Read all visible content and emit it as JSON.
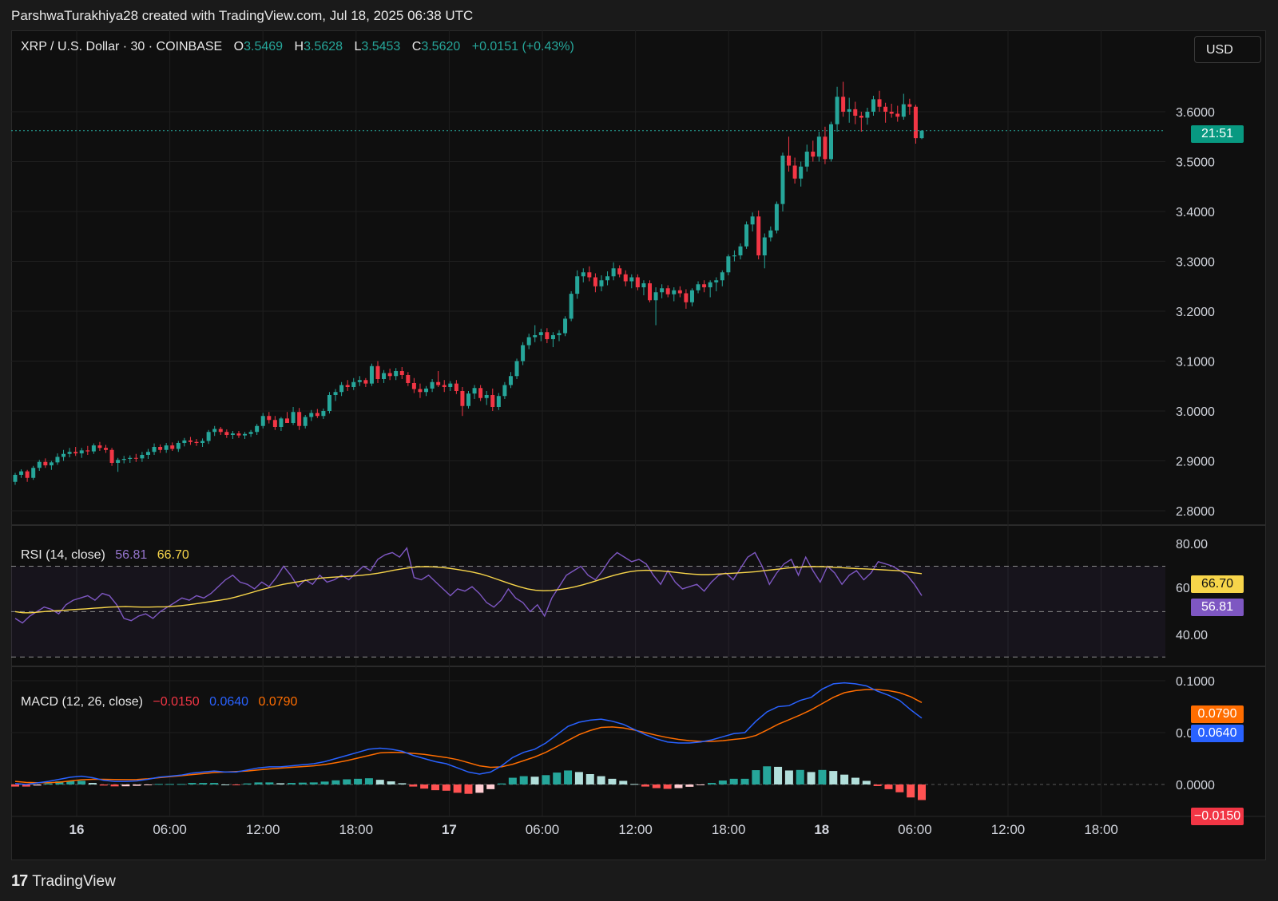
{
  "header": {
    "attribution": "ParshwaTurakhiya28 created with TradingView.com, Jul 18, 2025 06:38 UTC"
  },
  "symbol": {
    "title": "XRP / U.S. Dollar · 30 · COINBASE",
    "o_label": "O",
    "o": "3.5469",
    "h_label": "H",
    "h": "3.5628",
    "l_label": "L",
    "l": "3.5453",
    "c_label": "C",
    "c": "3.5620",
    "change": "+0.0151 (+0.43%)"
  },
  "currency_button": "USD",
  "price_tag": "21:51",
  "rsi": {
    "label": "RSI (14, close)",
    "value": "56.81",
    "ma": "66.70",
    "partial_tick": "60.00"
  },
  "macd": {
    "label": "MACD (12, 26, close)",
    "hist": "−0.0150",
    "macd": "0.0640",
    "signal": "0.0790"
  },
  "footer": {
    "brand": "TradingView",
    "logo_mark": "17"
  },
  "colors": {
    "up": "#26a69a",
    "down": "#f23645",
    "rsi_line": "#7e57c2",
    "rsi_ma": "#f7d54a",
    "macd_line": "#2962ff",
    "signal_line": "#ff6d00",
    "bg": "#0f0f0f"
  },
  "chart_data": {
    "type": "candlestick",
    "timeframe": "30",
    "x_tick_labels": [
      "16",
      "06:00",
      "12:00",
      "18:00",
      "17",
      "06:00",
      "12:00",
      "18:00",
      "18",
      "06:00",
      "12:00",
      "18:00"
    ],
    "price_axis": {
      "ticks": [
        "3.6000",
        "3.5000",
        "3.4000",
        "3.3000",
        "3.2000",
        "3.1000",
        "3.0000",
        "2.9000",
        "2.8000"
      ],
      "last": 3.562
    },
    "rsi_axis": {
      "ticks": [
        "80.00",
        "40.00"
      ],
      "bands": [
        70,
        50,
        30
      ]
    },
    "macd_axis": {
      "ticks": [
        "0.1000",
        "0.0500",
        "0.0000"
      ]
    },
    "candles": [
      [
        2.858,
        2.876,
        2.852,
        2.872
      ],
      [
        2.872,
        2.883,
        2.866,
        2.879
      ],
      [
        2.879,
        2.882,
        2.858,
        2.866
      ],
      [
        2.866,
        2.89,
        2.862,
        2.886
      ],
      [
        2.886,
        2.902,
        2.88,
        2.898
      ],
      [
        2.898,
        2.905,
        2.886,
        2.891
      ],
      [
        2.891,
        2.9,
        2.882,
        2.897
      ],
      [
        2.897,
        2.915,
        2.892,
        2.908
      ],
      [
        2.908,
        2.922,
        2.9,
        2.914
      ],
      [
        2.914,
        2.926,
        2.907,
        2.918
      ],
      [
        2.918,
        2.928,
        2.91,
        2.915
      ],
      [
        2.915,
        2.926,
        2.906,
        2.921
      ],
      [
        2.921,
        2.93,
        2.912,
        2.919
      ],
      [
        2.919,
        2.935,
        2.914,
        2.931
      ],
      [
        2.931,
        2.938,
        2.92,
        2.926
      ],
      [
        2.926,
        2.932,
        2.916,
        2.922
      ],
      [
        2.922,
        2.926,
        2.89,
        2.896
      ],
      [
        2.896,
        2.906,
        2.878,
        2.902
      ],
      [
        2.902,
        2.91,
        2.895,
        2.904
      ],
      [
        2.904,
        2.911,
        2.896,
        2.906
      ],
      [
        2.906,
        2.914,
        2.898,
        2.905
      ],
      [
        2.905,
        2.918,
        2.898,
        2.912
      ],
      [
        2.912,
        2.924,
        2.904,
        2.918
      ],
      [
        2.918,
        2.935,
        2.912,
        2.928
      ],
      [
        2.928,
        2.933,
        2.916,
        2.922
      ],
      [
        2.922,
        2.936,
        2.916,
        2.931
      ],
      [
        2.931,
        2.937,
        2.92,
        2.924
      ],
      [
        2.924,
        2.94,
        2.918,
        2.936
      ],
      [
        2.936,
        2.946,
        2.929,
        2.941
      ],
      [
        2.941,
        2.948,
        2.932,
        2.938
      ],
      [
        2.938,
        2.944,
        2.93,
        2.936
      ],
      [
        2.936,
        2.945,
        2.928,
        2.94
      ],
      [
        2.94,
        2.962,
        2.934,
        2.958
      ],
      [
        2.958,
        2.97,
        2.95,
        2.964
      ],
      [
        2.964,
        2.968,
        2.952,
        2.958
      ],
      [
        2.958,
        2.963,
        2.946,
        2.952
      ],
      [
        2.952,
        2.96,
        2.944,
        2.955
      ],
      [
        2.955,
        2.96,
        2.946,
        2.951
      ],
      [
        2.951,
        2.958,
        2.944,
        2.954
      ],
      [
        2.954,
        2.962,
        2.948,
        2.958
      ],
      [
        2.958,
        2.974,
        2.952,
        2.97
      ],
      [
        2.97,
        2.996,
        2.965,
        2.99
      ],
      [
        2.99,
        2.998,
        2.975,
        2.982
      ],
      [
        2.982,
        2.99,
        2.962,
        2.968
      ],
      [
        2.968,
        2.988,
        2.96,
        2.985
      ],
      [
        2.985,
        2.998,
        2.978,
        2.976
      ],
      [
        2.976,
        3.008,
        2.972,
        2.998
      ],
      [
        2.998,
        3.006,
        2.962,
        2.97
      ],
      [
        2.97,
        2.992,
        2.965,
        2.988
      ],
      [
        2.988,
        3.002,
        2.98,
        2.996
      ],
      [
        2.996,
        3.004,
        2.986,
        2.99
      ],
      [
        2.99,
        3.005,
        2.984,
        3.0
      ],
      [
        3.0,
        3.038,
        2.995,
        3.032
      ],
      [
        3.032,
        3.044,
        3.02,
        3.038
      ],
      [
        3.038,
        3.058,
        3.03,
        3.052
      ],
      [
        3.052,
        3.062,
        3.04,
        3.048
      ],
      [
        3.048,
        3.066,
        3.042,
        3.058
      ],
      [
        3.058,
        3.07,
        3.05,
        3.062
      ],
      [
        3.062,
        3.066,
        3.048,
        3.055
      ],
      [
        3.055,
        3.095,
        3.05,
        3.09
      ],
      [
        3.09,
        3.1,
        3.056,
        3.064
      ],
      [
        3.064,
        3.082,
        3.056,
        3.076
      ],
      [
        3.076,
        3.085,
        3.062,
        3.07
      ],
      [
        3.07,
        3.086,
        3.062,
        3.08
      ],
      [
        3.08,
        3.088,
        3.064,
        3.072
      ],
      [
        3.072,
        3.078,
        3.05,
        3.056
      ],
      [
        3.056,
        3.066,
        3.036,
        3.044
      ],
      [
        3.044,
        3.055,
        3.026,
        3.038
      ],
      [
        3.038,
        3.05,
        3.03,
        3.045
      ],
      [
        3.045,
        3.064,
        3.038,
        3.058
      ],
      [
        3.058,
        3.08,
        3.048,
        3.052
      ],
      [
        3.052,
        3.062,
        3.038,
        3.048
      ],
      [
        3.048,
        3.06,
        3.04,
        3.055
      ],
      [
        3.055,
        3.062,
        3.034,
        3.04
      ],
      [
        3.04,
        3.048,
        2.99,
        3.01
      ],
      [
        3.01,
        3.04,
        3.005,
        3.035
      ],
      [
        3.035,
        3.052,
        3.024,
        3.046
      ],
      [
        3.046,
        3.052,
        3.02,
        3.026
      ],
      [
        3.026,
        3.04,
        3.012,
        3.032
      ],
      [
        3.032,
        3.045,
        3.0,
        3.008
      ],
      [
        3.008,
        3.036,
        3.002,
        3.03
      ],
      [
        3.03,
        3.058,
        3.024,
        3.052
      ],
      [
        3.052,
        3.078,
        3.046,
        3.07
      ],
      [
        3.07,
        3.105,
        3.064,
        3.1
      ],
      [
        3.1,
        3.138,
        3.092,
        3.132
      ],
      [
        3.132,
        3.155,
        3.124,
        3.148
      ],
      [
        3.148,
        3.172,
        3.138,
        3.152
      ],
      [
        3.152,
        3.165,
        3.14,
        3.158
      ],
      [
        3.158,
        3.166,
        3.136,
        3.144
      ],
      [
        3.144,
        3.158,
        3.128,
        3.152
      ],
      [
        3.152,
        3.162,
        3.14,
        3.156
      ],
      [
        3.156,
        3.19,
        3.15,
        3.185
      ],
      [
        3.185,
        3.24,
        3.18,
        3.235
      ],
      [
        3.235,
        3.282,
        3.225,
        3.27
      ],
      [
        3.27,
        3.286,
        3.258,
        3.278
      ],
      [
        3.278,
        3.29,
        3.26,
        3.268
      ],
      [
        3.268,
        3.276,
        3.238,
        3.25
      ],
      [
        3.25,
        3.272,
        3.24,
        3.262
      ],
      [
        3.262,
        3.28,
        3.252,
        3.27
      ],
      [
        3.27,
        3.298,
        3.262,
        3.286
      ],
      [
        3.286,
        3.292,
        3.268,
        3.274
      ],
      [
        3.274,
        3.282,
        3.25,
        3.26
      ],
      [
        3.26,
        3.274,
        3.246,
        3.268
      ],
      [
        3.268,
        3.274,
        3.242,
        3.248
      ],
      [
        3.248,
        3.262,
        3.232,
        3.256
      ],
      [
        3.256,
        3.262,
        3.218,
        3.222
      ],
      [
        3.222,
        3.248,
        3.172,
        3.238
      ],
      [
        3.238,
        3.254,
        3.226,
        3.246
      ],
      [
        3.246,
        3.252,
        3.228,
        3.234
      ],
      [
        3.234,
        3.248,
        3.22,
        3.242
      ],
      [
        3.242,
        3.25,
        3.228,
        3.236
      ],
      [
        3.236,
        3.244,
        3.205,
        3.218
      ],
      [
        3.218,
        3.246,
        3.21,
        3.242
      ],
      [
        3.242,
        3.26,
        3.236,
        3.254
      ],
      [
        3.254,
        3.262,
        3.238,
        3.248
      ],
      [
        3.248,
        3.262,
        3.228,
        3.258
      ],
      [
        3.258,
        3.268,
        3.24,
        3.262
      ],
      [
        3.262,
        3.282,
        3.25,
        3.278
      ],
      [
        3.278,
        3.314,
        3.272,
        3.31
      ],
      [
        3.31,
        3.322,
        3.3,
        3.312
      ],
      [
        3.312,
        3.336,
        3.304,
        3.33
      ],
      [
        3.33,
        3.38,
        3.325,
        3.374
      ],
      [
        3.374,
        3.398,
        3.36,
        3.39
      ],
      [
        3.39,
        3.402,
        3.304,
        3.312
      ],
      [
        3.312,
        3.356,
        3.286,
        3.348
      ],
      [
        3.348,
        3.37,
        3.34,
        3.362
      ],
      [
        3.362,
        3.42,
        3.356,
        3.415
      ],
      [
        3.415,
        3.518,
        3.4,
        3.512
      ],
      [
        3.512,
        3.55,
        3.48,
        3.492
      ],
      [
        3.492,
        3.508,
        3.456,
        3.466
      ],
      [
        3.466,
        3.5,
        3.45,
        3.49
      ],
      [
        3.49,
        3.534,
        3.48,
        3.52
      ],
      [
        3.52,
        3.542,
        3.5,
        3.51
      ],
      [
        3.51,
        3.56,
        3.5,
        3.55
      ],
      [
        3.55,
        3.57,
        3.495,
        3.505
      ],
      [
        3.505,
        3.58,
        3.5,
        3.575
      ],
      [
        3.575,
        3.65,
        3.56,
        3.63
      ],
      [
        3.63,
        3.66,
        3.59,
        3.6
      ],
      [
        3.6,
        3.628,
        3.578,
        3.605
      ],
      [
        3.605,
        3.62,
        3.575,
        3.592
      ],
      [
        3.592,
        3.6,
        3.56,
        3.588
      ],
      [
        3.588,
        3.608,
        3.574,
        3.6
      ],
      [
        3.6,
        3.632,
        3.592,
        3.625
      ],
      [
        3.625,
        3.642,
        3.6,
        3.61
      ],
      [
        3.61,
        3.618,
        3.578,
        3.6
      ],
      [
        3.6,
        3.616,
        3.588,
        3.596
      ],
      [
        3.596,
        3.612,
        3.58,
        3.59
      ],
      [
        3.59,
        3.636,
        3.584,
        3.615
      ],
      [
        3.615,
        3.626,
        3.594,
        3.61
      ],
      [
        3.61,
        3.614,
        3.536,
        3.547
      ],
      [
        3.547,
        3.563,
        3.545,
        3.562
      ]
    ],
    "rsi_values": [
      47,
      45,
      48,
      50,
      52,
      51,
      49,
      53,
      55,
      56,
      57,
      55,
      58,
      57,
      53,
      47,
      46,
      48,
      49,
      47,
      50,
      52,
      54,
      56,
      55,
      57,
      56,
      58,
      61,
      64,
      66,
      63,
      62,
      60,
      63,
      61,
      65,
      70,
      66,
      61,
      64,
      62,
      66,
      63,
      64,
      66,
      64,
      67,
      70,
      68,
      73,
      75,
      76,
      74,
      78,
      65,
      64,
      66,
      63,
      60,
      57,
      60,
      59,
      61,
      58,
      54,
      52,
      55,
      60,
      56,
      54,
      50,
      53,
      48,
      56,
      61,
      66,
      68,
      70,
      66,
      64,
      68,
      73,
      76,
      74,
      72,
      73,
      71,
      66,
      62,
      68,
      63,
      60,
      61,
      62,
      59,
      63,
      66,
      67,
      64,
      69,
      74,
      76,
      70,
      62,
      67,
      71,
      73,
      66,
      74,
      68,
      63,
      70,
      67,
      62,
      66,
      68,
      64,
      67,
      72,
      71,
      70,
      68,
      66,
      62,
      57
    ],
    "rsi_ma_values": [
      50,
      49.5,
      49.5,
      49.8,
      50.1,
      50.3,
      50.5,
      50.8,
      51,
      51.2,
      51.5,
      51.7,
      52,
      52.1,
      52.2,
      52.1,
      52,
      52,
      52.1,
      52.1,
      52.3,
      52.6,
      53,
      53.5,
      54,
      54.5,
      55,
      55.6,
      56.4,
      57.4,
      58.4,
      59.4,
      60.3,
      61.2,
      62,
      62.6,
      63.2,
      63.8,
      64.4,
      64.8,
      65.1,
      65.3,
      65.5,
      65.7,
      66,
      66.4,
      66.9,
      67.5,
      68.2,
      68.8,
      69.3,
      69.7,
      69.8,
      69.7,
      69.5,
      69.1,
      68.6,
      68,
      67.4,
      66.6,
      65.6,
      64.4,
      63.2,
      62,
      60.9,
      60,
      59.4,
      59.2,
      59.3,
      59.7,
      60.2,
      60.9,
      61.8,
      62.8,
      63.9,
      65,
      66,
      66.9,
      67.6,
      68,
      68.2,
      68.1,
      67.9,
      67.6,
      67.2,
      66.8,
      66.5,
      66.3,
      66.3,
      66.5,
      66.7,
      66.9,
      67.1,
      67.3,
      67.6,
      68,
      68.4,
      68.8,
      69.2,
      69.5,
      69.7,
      69.8,
      69.8,
      69.7,
      69.5,
      69.3,
      69.1,
      68.9,
      68.8,
      68.6,
      68.4,
      68.2,
      68,
      67.6,
      67.1,
      66.7
    ],
    "macd_line": [
      0.001,
      0,
      0.0015,
      0.003,
      0.005,
      0.007,
      0.008,
      0.0065,
      0.004,
      0.003,
      0.003,
      0.0035,
      0.005,
      0.007,
      0.008,
      0.009,
      0.011,
      0.012,
      0.013,
      0.012,
      0.012,
      0.014,
      0.016,
      0.017,
      0.017,
      0.018,
      0.019,
      0.02,
      0.022,
      0.025,
      0.028,
      0.031,
      0.034,
      0.035,
      0.034,
      0.032,
      0.028,
      0.025,
      0.022,
      0.02,
      0.016,
      0.012,
      0.01,
      0.012,
      0.018,
      0.026,
      0.031,
      0.034,
      0.04,
      0.048,
      0.056,
      0.06,
      0.062,
      0.063,
      0.061,
      0.058,
      0.053,
      0.048,
      0.044,
      0.041,
      0.04,
      0.04,
      0.041,
      0.043,
      0.046,
      0.049,
      0.05,
      0.061,
      0.07,
      0.075,
      0.076,
      0.081,
      0.084,
      0.092,
      0.097,
      0.098,
      0.097,
      0.095,
      0.09,
      0.086,
      0.081,
      0.072,
      0.064
    ],
    "signal_line": [
      0.003,
      0.002,
      0.0018,
      0.0018,
      0.0022,
      0.0035,
      0.0045,
      0.005,
      0.005,
      0.0048,
      0.0047,
      0.0048,
      0.0055,
      0.0065,
      0.0075,
      0.0085,
      0.0095,
      0.0105,
      0.0115,
      0.012,
      0.0125,
      0.013,
      0.014,
      0.015,
      0.0158,
      0.0165,
      0.0172,
      0.018,
      0.0192,
      0.021,
      0.023,
      0.0255,
      0.028,
      0.0305,
      0.031,
      0.0308,
      0.03,
      0.029,
      0.0275,
      0.026,
      0.024,
      0.021,
      0.018,
      0.0165,
      0.017,
      0.0195,
      0.023,
      0.0265,
      0.031,
      0.0365,
      0.0425,
      0.048,
      0.052,
      0.055,
      0.0555,
      0.0545,
      0.0525,
      0.05,
      0.0475,
      0.0452,
      0.0435,
      0.0422,
      0.0415,
      0.0415,
      0.0422,
      0.0435,
      0.0445,
      0.0472,
      0.0525,
      0.058,
      0.0625,
      0.067,
      0.072,
      0.078,
      0.084,
      0.0885,
      0.0905,
      0.0915,
      0.0915,
      0.0905,
      0.0885,
      0.0845,
      0.079
    ],
    "macd_hist": [
      -0.002,
      -0.002,
      -0.001,
      0.001,
      0.003,
      0.0035,
      0.0035,
      0.0015,
      -0.001,
      -0.0018,
      -0.0017,
      -0.0013,
      -0.0005,
      0.0005,
      0.0005,
      0.0005,
      0.0015,
      0.0015,
      0.0015,
      0,
      -0.0005,
      0.001,
      0.002,
      0.002,
      0.0012,
      0.0015,
      0.0018,
      0.002,
      0.0028,
      0.004,
      0.005,
      0.0055,
      0.006,
      0.0045,
      0.003,
      0.0012,
      -0.002,
      -0.004,
      -0.0055,
      -0.006,
      -0.008,
      -0.009,
      -0.008,
      -0.0045,
      0.001,
      0.0065,
      0.008,
      0.0075,
      0.009,
      0.0115,
      0.0135,
      0.012,
      0.01,
      0.008,
      0.0055,
      0.0035,
      0.0005,
      -0.002,
      -0.0035,
      -0.0042,
      -0.0035,
      -0.0022,
      -0.0005,
      0.0015,
      0.0038,
      0.0055,
      0.0055,
      0.0138,
      0.0175,
      0.017,
      0.0135,
      0.014,
      0.012,
      0.014,
      0.013,
      0.0095,
      0.0065,
      0.0035,
      -0.0015,
      -0.0045,
      -0.0075,
      -0.0125,
      -0.015
    ]
  }
}
